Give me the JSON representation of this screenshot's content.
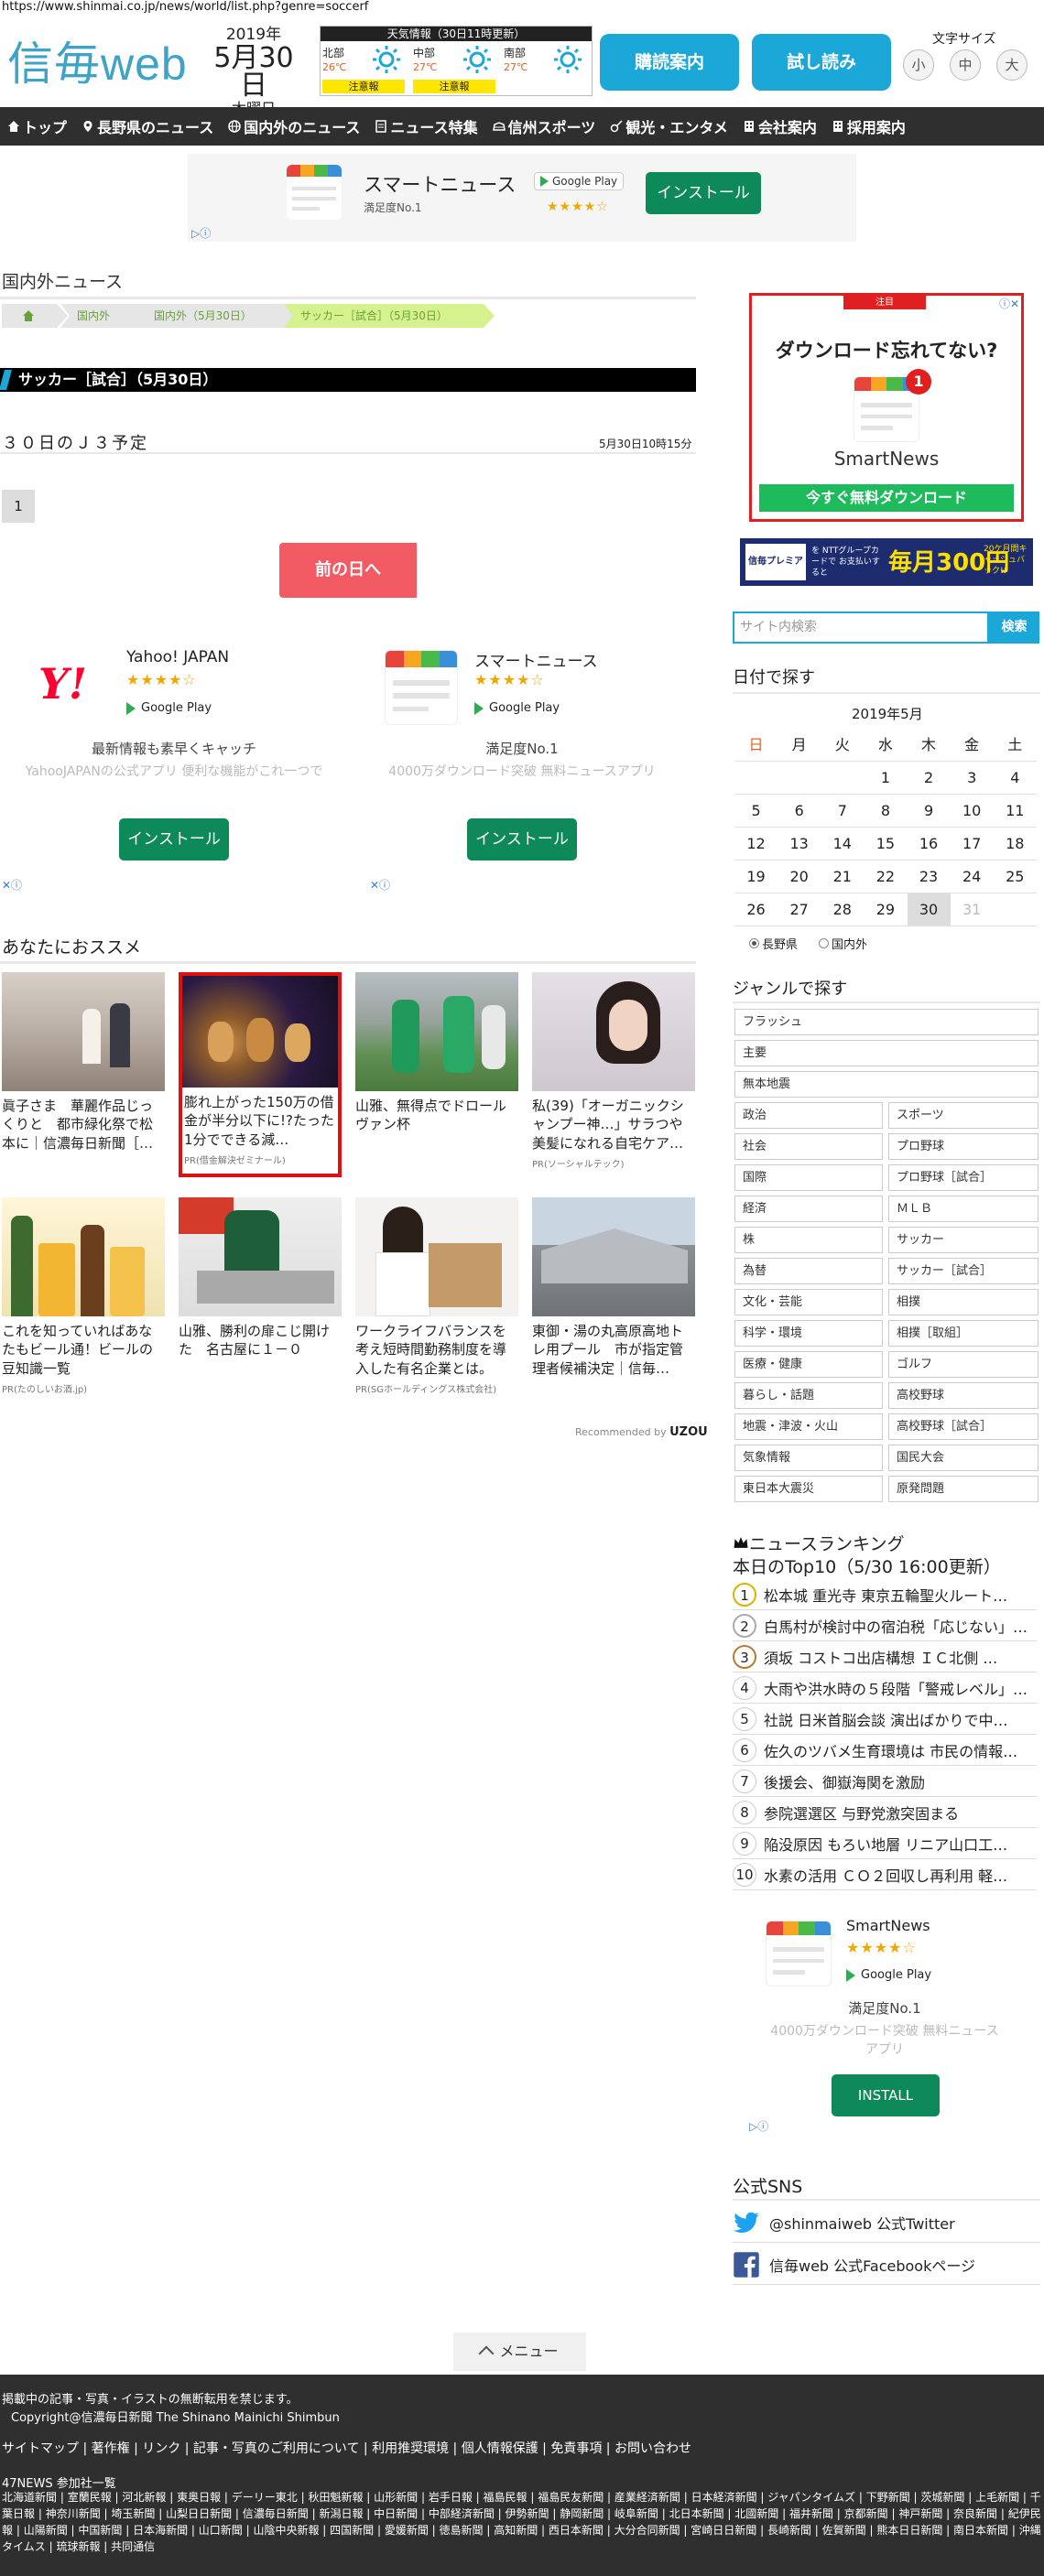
{
  "url": "https://www.shinmai.co.jp/news/world/list.php?genre=soccerf",
  "header": {
    "logo_main": "信毎",
    "logo_sub": "web",
    "year": "2019年",
    "month_day": "5月30日",
    "weekday": "木曜日",
    "weather_title": "天気情報（30日11時更新）",
    "weather": [
      {
        "region": "北部",
        "temp": "26℃",
        "alert": "注意報"
      },
      {
        "region": "中部",
        "temp": "27℃",
        "alert": "注意報"
      },
      {
        "region": "南部",
        "temp": "27℃",
        "alert": ""
      }
    ],
    "subscribe_label": "購読案内",
    "trial_label": "試し読み",
    "font_size_label": "文字サイズ",
    "font_sizes": [
      "小",
      "中",
      "大"
    ]
  },
  "nav": [
    "トップ",
    "長野県のニュース",
    "国内外のニュース",
    "ニュース特集",
    "信州スポーツ",
    "観光・エンタメ",
    "会社案内",
    "採用案内"
  ],
  "ad_top": {
    "name": "スマートニュース",
    "sub": "満足度No.1",
    "store": "Google Play",
    "rating": "★★★★☆",
    "install": "インストール"
  },
  "main": {
    "section_title": "国内外ニュース",
    "breadcrumb": [
      "国内外",
      "国内外（5月30日）",
      "サッカー［試合］（5月30日）"
    ],
    "category": "サッカー［試合］（5月30日）",
    "article_title": "３０日のＪ３予定",
    "article_time": "5月30日10時15分",
    "page": "1",
    "prev_day": "前の日へ"
  },
  "mid_ads": [
    {
      "name": "Yahoo! JAPAN",
      "logo": "Y!",
      "rating": "★★★★☆",
      "store": "Google Play",
      "desc": "最新情報も素早くキャッチ",
      "desc2": "YahooJAPANの公式アプリ 便利な機能がこれ一つで",
      "install": "インストール"
    },
    {
      "name": "スマートニュース",
      "rating": "★★★★☆",
      "store": "Google Play",
      "desc": "満足度No.1",
      "desc2": "4000万ダウンロード突破 無料ニュースアプリ",
      "install": "インストール"
    }
  ],
  "recommend": {
    "heading": "あなたにおススメ",
    "cards": [
      {
        "caption": "眞子さま　華麗作品じっくりと　都市緑化祭で松本に｜信濃毎日新聞［…",
        "pr": ""
      },
      {
        "caption": "膨れ上がった150万の借金が半分以下に!?たった1分でできる減…",
        "pr": "PR(借金解決ゼミナール)"
      },
      {
        "caption": "山雅、無得点でドロールヴァン杯",
        "pr": ""
      },
      {
        "caption": "私(39)「オーガニックシャンプー神…」サラつや美髪になれる自宅ケア…",
        "pr": "PR(ソーシャルテック)"
      },
      {
        "caption": "これを知っていればあなたもビール通！ビールの豆知識一覧",
        "pr": "PR(たのしいお酒.jp)"
      },
      {
        "caption": "山雅、勝利の扉こじ開けた　名古屋に１－０",
        "pr": ""
      },
      {
        "caption": "ワークライフバランスを考え短時間勤務制度を導入した有名企業とは。",
        "pr": "PR(SGホールディングス株式会社)"
      },
      {
        "caption": "東御・湯の丸高原高地トレ用プール　市が指定管理者候補決定｜信毎…",
        "pr": ""
      }
    ],
    "credit": "Recommended by",
    "credit_brand": "UZOU"
  },
  "sidebar": {
    "ad": {
      "tag": "注目",
      "title": "ダウンロード忘れてない?",
      "badge": "1",
      "app": "SmartNews",
      "button": "今すぐ無料ダウンロード"
    },
    "premium": {
      "left": "信毎プレミアム",
      "mid": "を NTTグループカードで お支払いすると",
      "big": "毎月300円",
      "right": "20ケ月間キャッシュバック!!"
    },
    "search_placeholder": "サイト内検索",
    "search_button": "検索",
    "date_heading": "日付で探す",
    "calendar": {
      "month": "2019年5月",
      "weekdays": [
        "日",
        "月",
        "火",
        "水",
        "木",
        "金",
        "土"
      ],
      "weeks": [
        [
          "",
          "",
          "",
          "1",
          "2",
          "3",
          "4"
        ],
        [
          "5",
          "6",
          "7",
          "8",
          "9",
          "10",
          "11"
        ],
        [
          "12",
          "13",
          "14",
          "15",
          "16",
          "17",
          "18"
        ],
        [
          "19",
          "20",
          "21",
          "22",
          "23",
          "24",
          "25"
        ],
        [
          "26",
          "27",
          "28",
          "29",
          "30",
          "31",
          ""
        ]
      ],
      "today": "30"
    },
    "radio": [
      "長野県",
      "国内外"
    ],
    "genre_heading": "ジャンルで探す",
    "genres_full": [
      "フラッシュ",
      "主要",
      "無本地震"
    ],
    "genres": [
      [
        "政治",
        "スポーツ"
      ],
      [
        "社会",
        "プロ野球"
      ],
      [
        "国際",
        "プロ野球［試合］"
      ],
      [
        "経済",
        "ＭＬＢ"
      ],
      [
        "株",
        "サッカー"
      ],
      [
        "為替",
        "サッカー［試合］"
      ],
      [
        "文化・芸能",
        "相撲"
      ],
      [
        "科学・環境",
        "相撲［取組］"
      ],
      [
        "医療・健康",
        "ゴルフ"
      ],
      [
        "暮らし・話題",
        "高校野球"
      ],
      [
        "地震・津波・火山",
        "高校野球［試合］"
      ],
      [
        "気象情報",
        "国民大会"
      ],
      [
        "東日本大震災",
        "原発問題"
      ]
    ],
    "ranking_heading": "ニュースランキング",
    "ranking_sub": "本日のTop10（5/30 16:00更新）",
    "ranking": [
      "松本城 重光寺 東京五輪聖火ルート…",
      "白馬村が検討中の宿泊税「応じない」…",
      "須坂 コストコ出店構想 ＩＣ北側 …",
      "大雨や洪水時の５段階「警戒レベル」…",
      "社説 日米首脳会談 演出ばかりで中…",
      "佐久のツバメ生育環境は 市民の情報…",
      "後援会、御嶽海関を激励",
      "参院選選区 与野党激突固まる",
      "陥没原因 もろい地層 リニア山口工…",
      "水素の活用 ＣＯ２回収し再利用 軽…"
    ],
    "ad2": {
      "name": "SmartNews",
      "rating": "★★★★☆",
      "store": "Google Play",
      "desc": "満足度No.1",
      "desc2": "4000万ダウンロード突破 無料ニュースアプリ",
      "install": "INSTALL"
    },
    "sns_heading": "公式SNS",
    "sns": [
      "@shinmaiweb 公式Twitter",
      "信毎web 公式Facebookページ"
    ]
  },
  "footer": {
    "menu": "メニュー",
    "notice": "掲載中の記事・写真・イラストの無断転用を禁じます。",
    "copyright": "Copyright@信濃毎日新聞 The Shinano Mainichi Shimbun",
    "links": [
      "サイトマップ",
      "著作権",
      "リンク",
      "記事・写真のご利用について",
      "利用推奨環境",
      "個人情報保護",
      "免責事項",
      "お問い合わせ"
    ],
    "news_heading": "47NEWS 参加社一覧",
    "news": [
      "北海道新聞",
      "室蘭民報",
      "河北新報",
      "東奥日報",
      "デーリー東北",
      "秋田魁新報",
      "山形新聞",
      "岩手日報",
      "福島民報",
      "福島民友新聞",
      "産業経済新聞",
      "日本経済新聞",
      "ジャパンタイムズ",
      "下野新聞",
      "茨城新聞",
      "上毛新聞",
      "千葉日報",
      "神奈川新聞",
      "埼玉新聞",
      "山梨日日新聞",
      "信濃毎日新聞",
      "新潟日報",
      "中日新聞",
      "中部経済新聞",
      "伊勢新聞",
      "静岡新聞",
      "岐阜新聞",
      "北日本新聞",
      "北國新聞",
      "福井新聞",
      "京都新聞",
      "神戸新聞",
      "奈良新聞",
      "紀伊民報",
      "山陽新聞",
      "中国新聞",
      "日本海新聞",
      "山口新聞",
      "山陰中央新報",
      "四国新聞",
      "愛媛新聞",
      "徳島新聞",
      "高知新聞",
      "西日本新聞",
      "大分合同新聞",
      "宮崎日日新聞",
      "長崎新聞",
      "佐賀新聞",
      "熊本日日新聞",
      "南日本新聞",
      "沖縄タイムス",
      "琉球新報",
      "共同通信"
    ]
  },
  "colors": {
    "brand": "#3da3c7",
    "button": "#1ba8d8",
    "nav": "#2f2f2f",
    "prev": "#f25b64",
    "install": "#0e8a5a",
    "alert": "#ffe600"
  }
}
